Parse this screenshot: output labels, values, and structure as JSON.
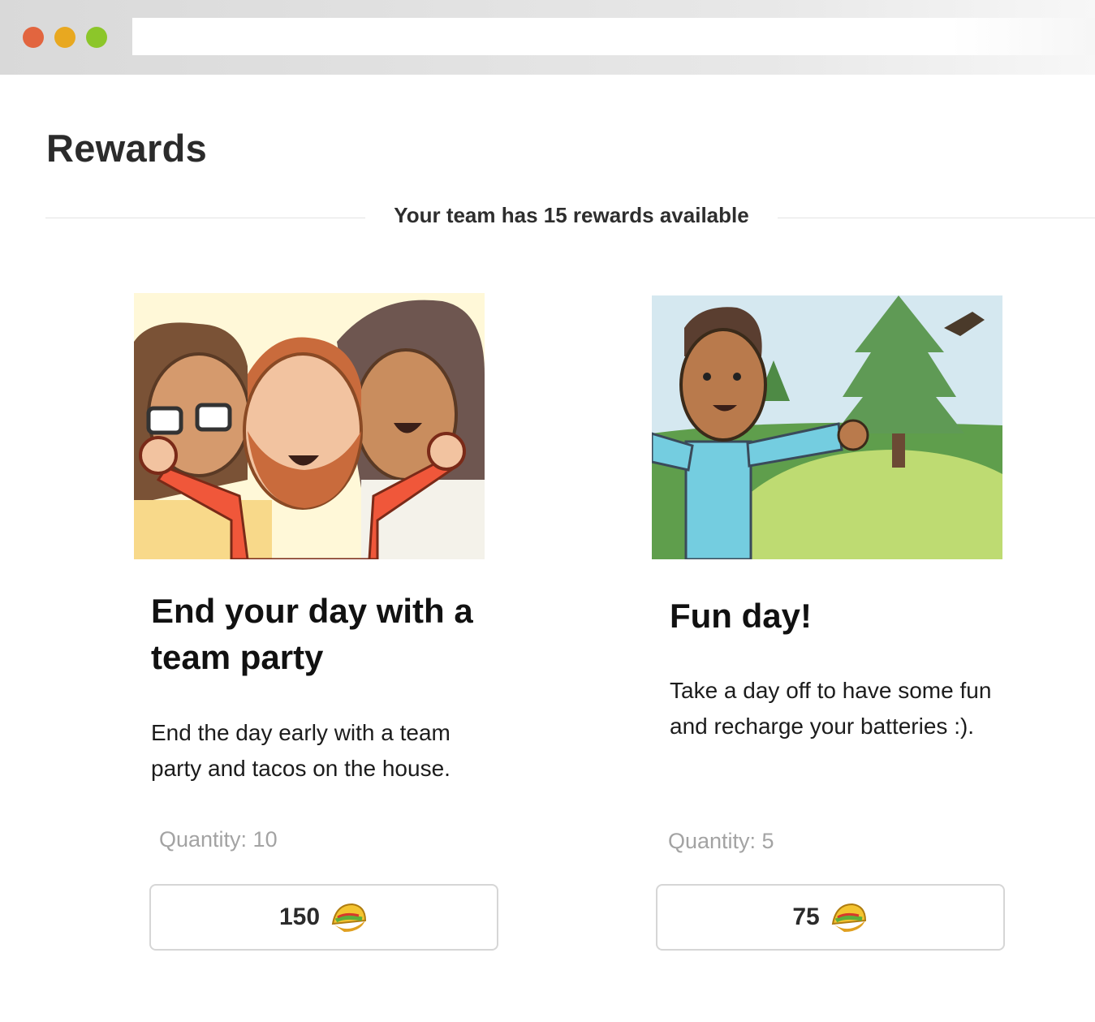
{
  "page": {
    "title": "Rewards",
    "summary": "Your team has 15 rewards available"
  },
  "rewards": [
    {
      "title": "End your day with a team party",
      "description": "End the day early with a team party and tacos on the house.",
      "quantity": "Quantity: 10",
      "price": "150",
      "price_icon": "taco-icon",
      "image_icon": "team-party-illustration"
    },
    {
      "title": "Fun day!",
      "description": "Take a day off to have some fun and recharge your batteries :).",
      "quantity": "Quantity: 5",
      "price": "75",
      "price_icon": "taco-icon",
      "image_icon": "fun-day-illustration"
    }
  ],
  "colors": {
    "window_close": "#e2653f",
    "window_minimize": "#e8a820",
    "window_maximize": "#8cc62a",
    "quantity_text": "#a3a3a3",
    "button_border": "#d6d6d6"
  }
}
